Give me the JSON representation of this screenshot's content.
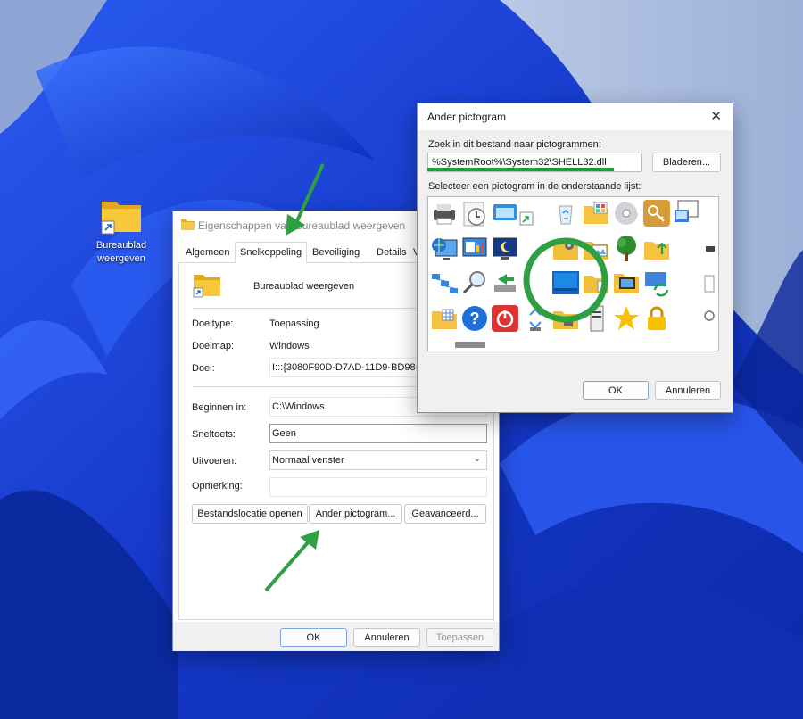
{
  "desktop": {
    "icon_label": "Bureaublad weergeven"
  },
  "properties_window": {
    "title": "Eigenschappen van Bureaublad weergeven",
    "tabs": [
      "Algemeen",
      "Snelkoppeling",
      "Beveiliging",
      "Details",
      "V"
    ],
    "active_tab": "Snelkoppeling",
    "shortcut_name": "Bureaublad weergeven",
    "target_type_label": "Doeltype:",
    "target_type_value": "Toepassing",
    "target_folder_label": "Doelmap:",
    "target_folder_value": "Windows",
    "target_label": "Doel:",
    "target_value": "I:::{3080F90D-D7AD-11D9-BD98-00",
    "start_in_label": "Beginnen in:",
    "start_in_value": "C:\\Windows",
    "shortcut_key_label": "Sneltoets:",
    "shortcut_key_value": "Geen",
    "run_label": "Uitvoeren:",
    "run_value": "Normaal venster",
    "comment_label": "Opmerking:",
    "comment_value": "",
    "open_location_button": "Bestandslocatie openen",
    "change_icon_button": "Ander pictogram...",
    "advanced_button": "Geavanceerd...",
    "ok_button": "OK",
    "cancel_button": "Annuleren",
    "apply_button": "Toepassen"
  },
  "change_icon_dialog": {
    "title": "Ander pictogram",
    "search_label": "Zoek in dit bestand naar pictogrammen:",
    "file_path": "%SystemRoot%\\System32\\SHELL32.dll",
    "browse_button": "Bladeren...",
    "select_label": "Selecteer een pictogram in de onderstaande lijst:",
    "ok_button": "OK",
    "cancel_button": "Annuleren"
  },
  "colors": {
    "annotation_green": "#2ea043",
    "wallpaper_blue": "#1d3fd0",
    "selection_blue": "#0078d4"
  }
}
